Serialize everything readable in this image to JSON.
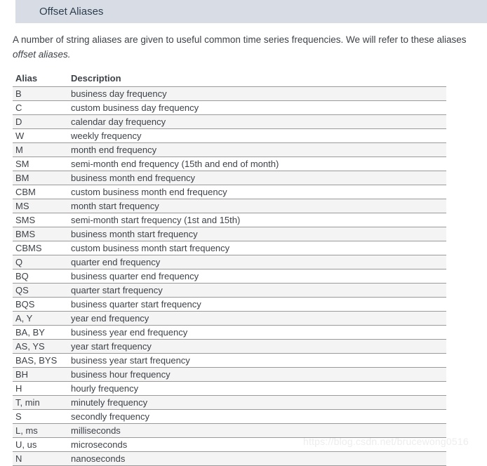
{
  "section": {
    "title": "Offset Aliases"
  },
  "intro": {
    "line1": "A number of string aliases are given to useful common time series frequencies. We will refer to these aliases",
    "line2": "offset aliases."
  },
  "table": {
    "columns": [
      "Alias",
      "Description"
    ],
    "rows": [
      {
        "alias": "B",
        "description": "business day frequency"
      },
      {
        "alias": "C",
        "description": "custom business day frequency"
      },
      {
        "alias": "D",
        "description": "calendar day frequency"
      },
      {
        "alias": "W",
        "description": "weekly frequency"
      },
      {
        "alias": "M",
        "description": "month end frequency"
      },
      {
        "alias": "SM",
        "description": "semi-month end frequency (15th and end of month)"
      },
      {
        "alias": "BM",
        "description": "business month end frequency"
      },
      {
        "alias": "CBM",
        "description": "custom business month end frequency"
      },
      {
        "alias": "MS",
        "description": "month start frequency"
      },
      {
        "alias": "SMS",
        "description": "semi-month start frequency (1st and 15th)"
      },
      {
        "alias": "BMS",
        "description": "business month start frequency"
      },
      {
        "alias": "CBMS",
        "description": "custom business month start frequency"
      },
      {
        "alias": "Q",
        "description": "quarter end frequency"
      },
      {
        "alias": "BQ",
        "description": "business quarter end frequency"
      },
      {
        "alias": "QS",
        "description": "quarter start frequency"
      },
      {
        "alias": "BQS",
        "description": "business quarter start frequency"
      },
      {
        "alias": "A, Y",
        "description": "year end frequency"
      },
      {
        "alias": "BA, BY",
        "description": "business year end frequency"
      },
      {
        "alias": "AS, YS",
        "description": "year start frequency"
      },
      {
        "alias": "BAS, BYS",
        "description": "business year start frequency"
      },
      {
        "alias": "BH",
        "description": "business hour frequency"
      },
      {
        "alias": "H",
        "description": "hourly frequency"
      },
      {
        "alias": "T, min",
        "description": "minutely frequency"
      },
      {
        "alias": "S",
        "description": "secondly frequency"
      },
      {
        "alias": "L, ms",
        "description": "milliseconds"
      },
      {
        "alias": "U, us",
        "description": "microseconds"
      },
      {
        "alias": "N",
        "description": "nanoseconds"
      }
    ]
  },
  "watermark": {
    "text": "https://blog.csdn.net/brucewong0516"
  },
  "colors": {
    "header_bar": "#d8dce4",
    "header_title": "#2c3e50",
    "body_text": "#3e4349",
    "row_stripe": "#f4f4f4",
    "row_border": "#9a9a9a",
    "page_background": "#ffffff",
    "watermark": "#ededed"
  }
}
